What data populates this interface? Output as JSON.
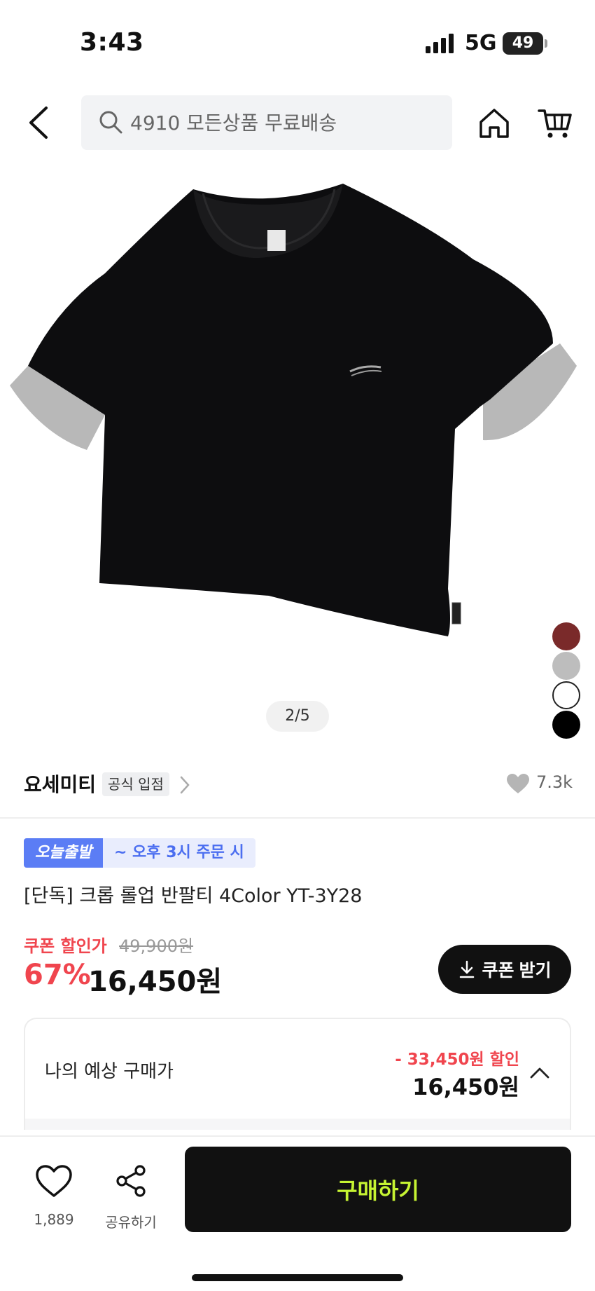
{
  "status_bar": {
    "time": "3:43",
    "network": "5G",
    "battery": "49"
  },
  "search": {
    "placeholder": "4910 모든상품 무료배송"
  },
  "product": {
    "image_counter": "2/5",
    "color_swatches": [
      "#7a2a2a",
      "#bdbdbd",
      "#ffffff",
      "#000000"
    ],
    "brand": "요세미티",
    "official_badge": "공식 입점",
    "like_count": "7.3k",
    "delivery_tag": "오늘출발",
    "delivery_info": "~ 오후 3시 주문 시",
    "title": "[단독] 크롭 롤업 반팔티 4Color YT-3Y28"
  },
  "price": {
    "coupon_label": "쿠폰 할인가",
    "original_price": "49,900원",
    "discount_rate": "67%",
    "final_price": "16,450원",
    "coupon_button": "쿠폰 받기"
  },
  "expected": {
    "label": "나의 예상 구매가",
    "discount": "- 33,450원 할인",
    "price": "16,450원"
  },
  "bottom_bar": {
    "wish_count": "1,889",
    "share_label": "공유하기",
    "buy_label": "구매하기"
  },
  "colors": {
    "accent_red": "#f0454e",
    "delivery_blue": "#5b7df5",
    "buy_text": "#c6f432"
  }
}
